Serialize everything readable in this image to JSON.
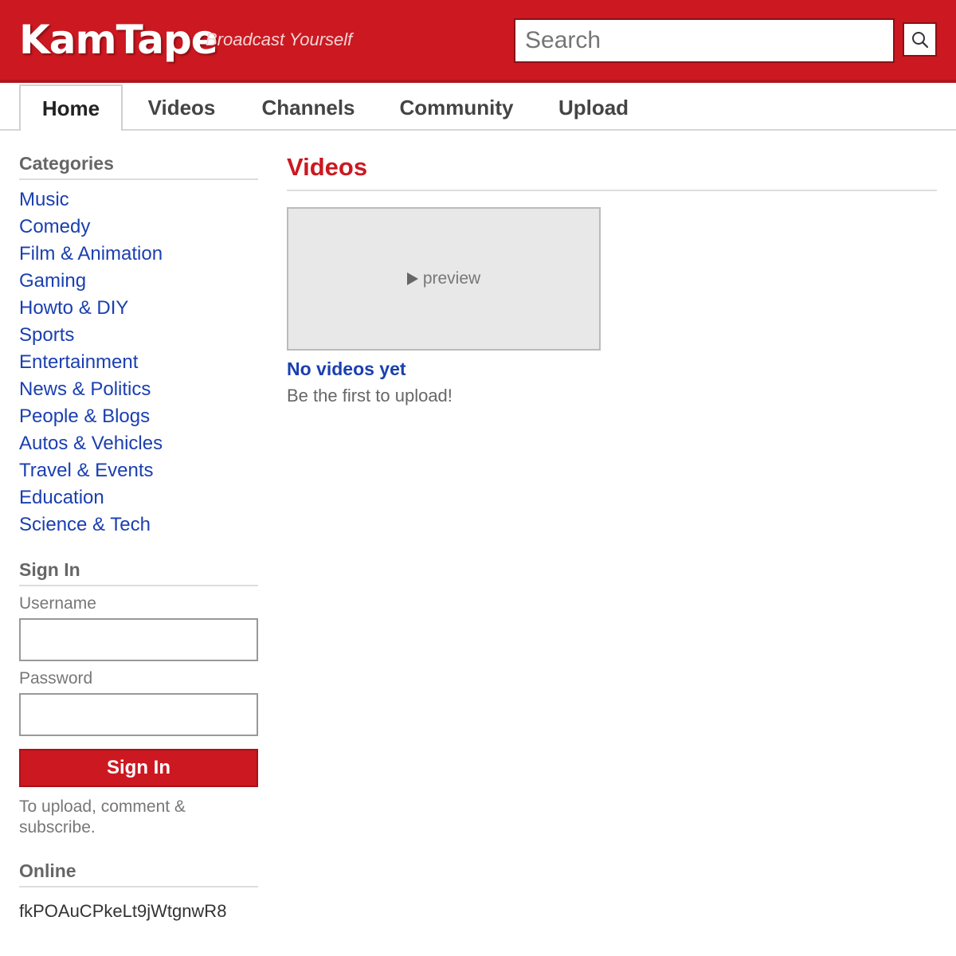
{
  "header": {
    "logo": "KamTape",
    "tagline": "Broadcast Yourself",
    "search_placeholder": "Search",
    "search_icon": "search-icon",
    "brand_color": "#cc1820"
  },
  "nav": {
    "tabs": [
      {
        "label": "Home",
        "active": true
      },
      {
        "label": "Videos",
        "active": false
      },
      {
        "label": "Channels",
        "active": false
      },
      {
        "label": "Community",
        "active": false
      },
      {
        "label": "Upload",
        "active": false
      }
    ]
  },
  "sidebar": {
    "categories_heading": "Categories",
    "categories": [
      "Music",
      "Comedy",
      "Film & Animation",
      "Gaming",
      "Howto & DIY",
      "Sports",
      "Entertainment",
      "News & Politics",
      "People & Blogs",
      "Autos & Vehicles",
      "Travel & Events",
      "Education",
      "Science & Tech"
    ],
    "signin": {
      "heading": "Sign In",
      "username_label": "Username",
      "password_label": "Password",
      "button_label": "Sign In",
      "note": "To upload, comment & subscribe."
    },
    "online": {
      "heading": "Online",
      "user": "fkPOAuCPkeLt9jWtgnwR8"
    }
  },
  "main": {
    "title": "Videos",
    "thumb_text": "preview",
    "video_title": "No videos yet",
    "video_subtitle": "Be the first to upload!"
  }
}
